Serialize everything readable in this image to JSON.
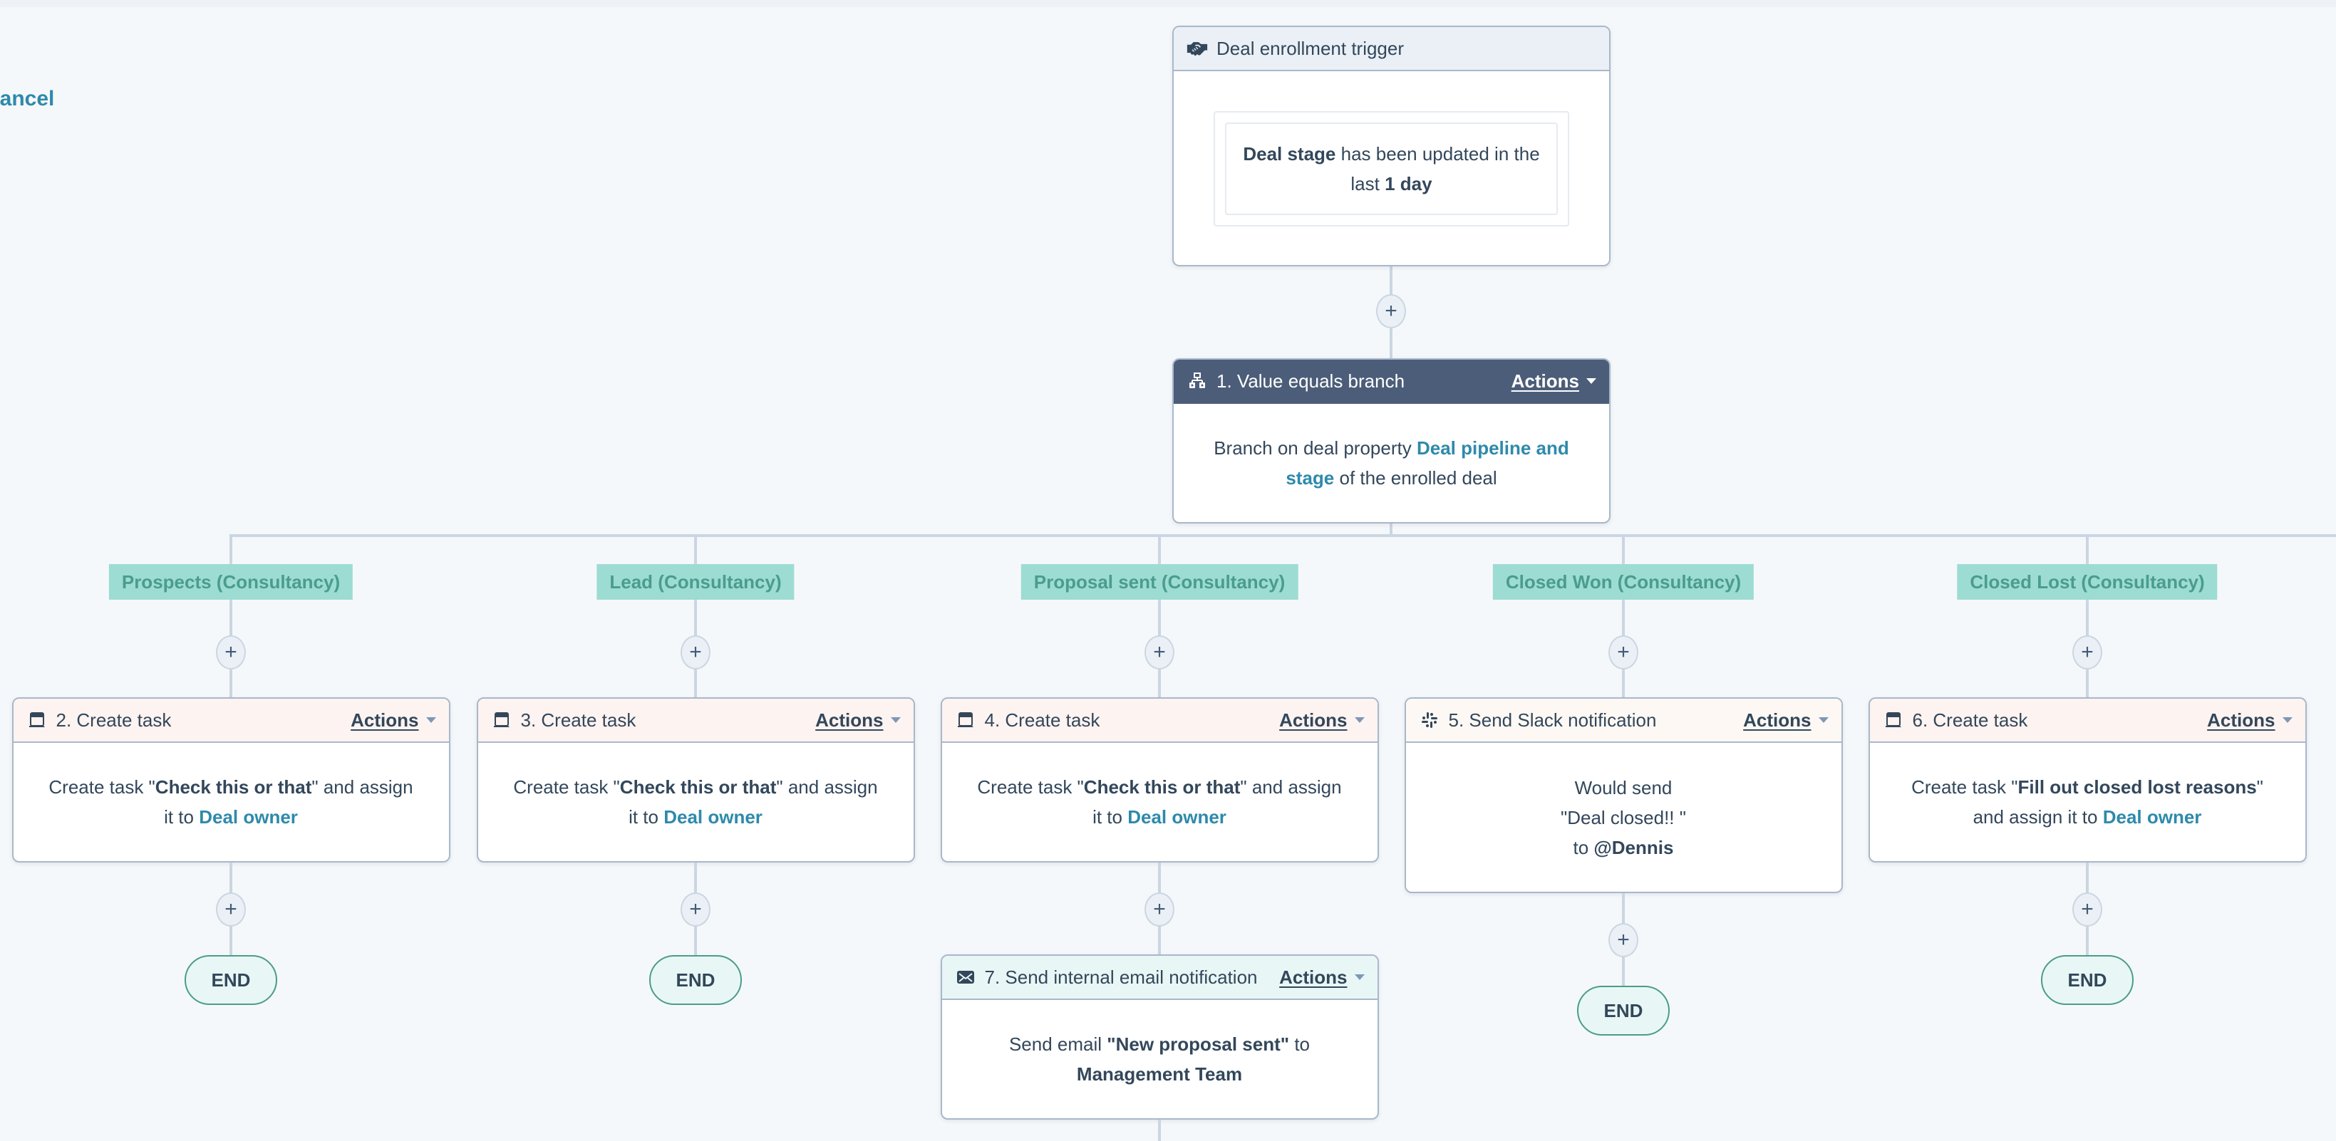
{
  "page": {
    "partial_link": "Cancel"
  },
  "trigger": {
    "title": "Deal enrollment trigger",
    "icon": "handshake-icon",
    "condition": {
      "property": "Deal stage",
      "middle": " has been updated in the last ",
      "value": "1 day"
    }
  },
  "branch": {
    "title": "1. Value equals branch",
    "icon": "branch-icon",
    "actions_label": "Actions",
    "body_prefix": "Branch on deal property ",
    "property_link": "Deal pipeline and stage",
    "body_suffix": " of the enrolled deal"
  },
  "branches": [
    {
      "label": "Prospects (Consultancy)",
      "steps": [
        {
          "title": "2. Create task",
          "icon": "task-icon",
          "type": "task",
          "actions_label": "Actions",
          "prefix": "Create task \"",
          "bold": "Check this or that",
          "mid": "\" and assign it to ",
          "link": "Deal owner"
        }
      ],
      "end_label": "END"
    },
    {
      "label": "Lead (Consultancy)",
      "steps": [
        {
          "title": "3. Create task",
          "icon": "task-icon",
          "type": "task",
          "actions_label": "Actions",
          "prefix": "Create task \"",
          "bold": "Check this or that",
          "mid": "\" and assign it to ",
          "link": "Deal owner"
        }
      ],
      "end_label": "END"
    },
    {
      "label": "Proposal sent (Consultancy)",
      "steps": [
        {
          "title": "4. Create task",
          "icon": "task-icon",
          "type": "task",
          "actions_label": "Actions",
          "prefix": "Create task \"",
          "bold": "Check this or that",
          "mid": "\" and assign it to ",
          "link": "Deal owner"
        },
        {
          "title": "7. Send internal email notification",
          "icon": "email-icon",
          "type": "email",
          "actions_label": "Actions",
          "prefix": "Send email ",
          "bold": "\"New proposal sent\"",
          "mid": " to ",
          "bold2": "Management Team"
        }
      ]
    },
    {
      "label": "Closed Won (Consultancy)",
      "steps": [
        {
          "title": "5. Send Slack notification",
          "icon": "slack-icon",
          "type": "slack",
          "actions_label": "Actions",
          "line1": "Would send",
          "line2": "\"Deal closed!! \"",
          "line3_prefix": "to ",
          "line3_bold": "@Dennis"
        }
      ],
      "end_label": "END"
    },
    {
      "label": "Closed Lost (Consultancy)",
      "steps": [
        {
          "title": "6. Create task",
          "icon": "task-icon",
          "type": "task",
          "actions_label": "Actions",
          "prefix": "Create task \"",
          "bold": "Fill out closed lost reasons",
          "mid": "\" and assign it to ",
          "link": "Deal owner"
        }
      ],
      "end_label": "END"
    }
  ],
  "plus_label": "+",
  "colors": {
    "background": "#f5f8fa",
    "connector": "#cbd6e2",
    "branch_header": "#4b5d78",
    "branch_label_bg": "#9ddcd3",
    "branch_label_text": "#4a9d8a",
    "link": "#2e8aab",
    "task_header": "#fdf3f0",
    "email_header": "#e8f6f5",
    "trigger_header": "#eaf0f6"
  }
}
